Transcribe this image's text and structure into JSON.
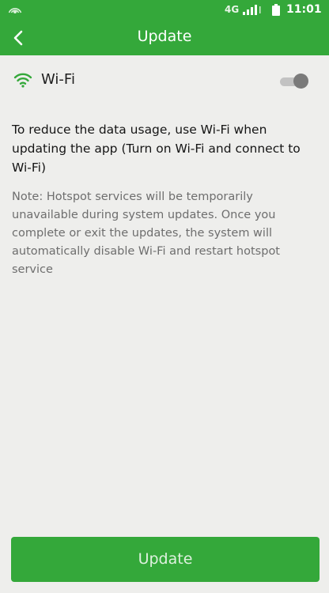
{
  "status_bar": {
    "network": "4G",
    "time": "11:01",
    "icons": [
      "hotspot-icon",
      "signal-icon",
      "battery-icon"
    ]
  },
  "header": {
    "title": "Update",
    "back_icon": "chevron-left-icon"
  },
  "wifi": {
    "label": "Wi-Fi",
    "icon": "wifi-icon",
    "enabled": false
  },
  "content": {
    "message": "To reduce the data usage, use Wi-Fi when updating the app (Turn on Wi-Fi and connect to Wi-Fi)",
    "note": "Note: Hotspot services will be temporarily unavailable during system updates. Once you complete or exit the updates, the system will automatically disable Wi-Fi and restart hotspot service"
  },
  "footer": {
    "update_label": "Update"
  },
  "colors": {
    "accent": "#34a83a",
    "background": "#eeeeec",
    "body_text": "#151515",
    "note_text": "#6e6e6e",
    "toggle_off": "#7a7a7a"
  }
}
